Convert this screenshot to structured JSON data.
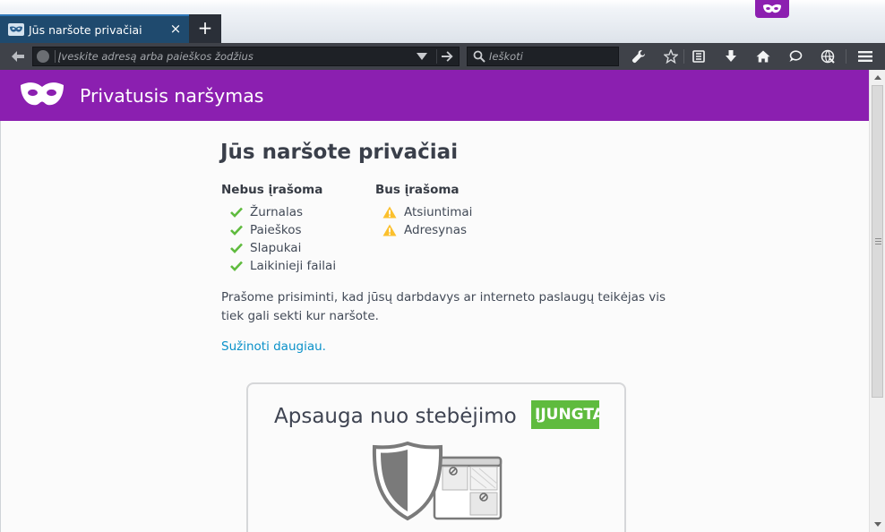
{
  "window": {
    "tab": {
      "title": "Jūs naršote privačiai",
      "close_glyph": "×",
      "favicon": "private-mask-icon"
    },
    "new_tab_glyph": "+",
    "private_indicator": "private-mask-icon"
  },
  "toolbar": {
    "url_placeholder": "Įveskite adresą arba paieškos žodžius",
    "url_value": "",
    "search_placeholder": "Ieškoti",
    "search_value": "",
    "buttons": [
      "back-icon",
      "go-arrow-icon",
      "wrench-icon",
      "bookmark-star-icon",
      "reading-list-icon",
      "download-icon",
      "home-icon",
      "chat-bubble-icon",
      "globe-grid-icon",
      "menu-icon"
    ]
  },
  "page": {
    "header_title": "Privatusis naršymas",
    "heading": "Jūs naršote privačiai",
    "not_saved": {
      "title": "Nebus įrašoma",
      "items": [
        "Žurnalas",
        "Paieškos",
        "Slapukai",
        "Laikinieji failai"
      ]
    },
    "saved": {
      "title": "Bus įrašoma",
      "items": [
        "Atsiuntimai",
        "Adresynas"
      ]
    },
    "note": "Prašome prisiminti, kad jūsų darbdavys ar interneto paslaugų teikėjas vis tiek gali sekti kur naršote.",
    "learn_more": "Sužinoti daugiau.",
    "tracking_protection": {
      "title": "Apsauga nuo stebėjimo",
      "status": "ĮJUNGTA"
    }
  },
  "colors": {
    "accent_purple": "#8b1fb0",
    "check_green": "#5fbb3e",
    "warning_yellow": "#fbc02d",
    "link_blue": "#0a91c9",
    "toolbar_dark": "#3f4249",
    "tab_blue": "#1f4a6e"
  }
}
